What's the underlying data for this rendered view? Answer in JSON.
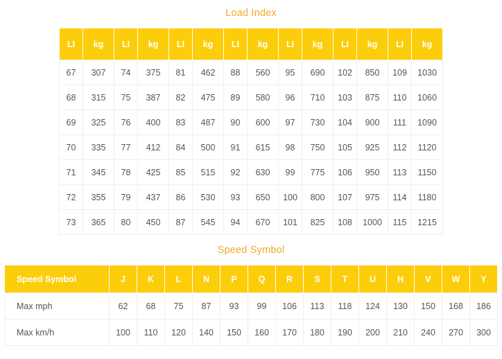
{
  "load_index": {
    "title": "Load Index",
    "headers": [
      "LI",
      "kg",
      "LI",
      "kg",
      "LI",
      "kg",
      "LI",
      "kg",
      "LI",
      "kg",
      "LI",
      "kg",
      "LI",
      "kg"
    ],
    "rows": [
      [
        "67",
        "307",
        "74",
        "375",
        "81",
        "462",
        "88",
        "560",
        "95",
        "690",
        "102",
        "850",
        "109",
        "1030"
      ],
      [
        "68",
        "315",
        "75",
        "387",
        "82",
        "475",
        "89",
        "580",
        "96",
        "710",
        "103",
        "875",
        "110",
        "1060"
      ],
      [
        "69",
        "325",
        "76",
        "400",
        "83",
        "487",
        "90",
        "600",
        "97",
        "730",
        "104",
        "900",
        "111",
        "1090"
      ],
      [
        "70",
        "335",
        "77",
        "412",
        "84",
        "500",
        "91",
        "615",
        "98",
        "750",
        "105",
        "925",
        "112",
        "1120"
      ],
      [
        "71",
        "345",
        "78",
        "425",
        "85",
        "515",
        "92",
        "630",
        "99",
        "775",
        "106",
        "950",
        "113",
        "1150"
      ],
      [
        "72",
        "355",
        "79",
        "437",
        "86",
        "530",
        "93",
        "650",
        "100",
        "800",
        "107",
        "975",
        "114",
        "1180"
      ],
      [
        "73",
        "365",
        "80",
        "450",
        "87",
        "545",
        "94",
        "670",
        "101",
        "825",
        "108",
        "1000",
        "115",
        "1215"
      ]
    ]
  },
  "speed_symbol": {
    "title": "Speed Symbol",
    "header_label": "Speed Symbol",
    "symbols": [
      "J",
      "K",
      "L",
      "N",
      "P",
      "Q",
      "R",
      "S",
      "T",
      "U",
      "H",
      "V",
      "W",
      "Y"
    ],
    "rows": [
      {
        "label": "Max mph",
        "values": [
          "62",
          "68",
          "75",
          "87",
          "93",
          "99",
          "106",
          "113",
          "118",
          "124",
          "130",
          "150",
          "168",
          "186"
        ]
      },
      {
        "label": "Max km/h",
        "values": [
          "100",
          "110",
          "120",
          "140",
          "150",
          "160",
          "170",
          "180",
          "190",
          "200",
          "210",
          "240",
          "270",
          "300"
        ]
      }
    ]
  },
  "colors": {
    "header_background": "#fccd0a",
    "title_text": "#f4a82a",
    "cell_text": "#555555",
    "cell_border": "#eeeeee",
    "page_background": "#ffffff"
  }
}
